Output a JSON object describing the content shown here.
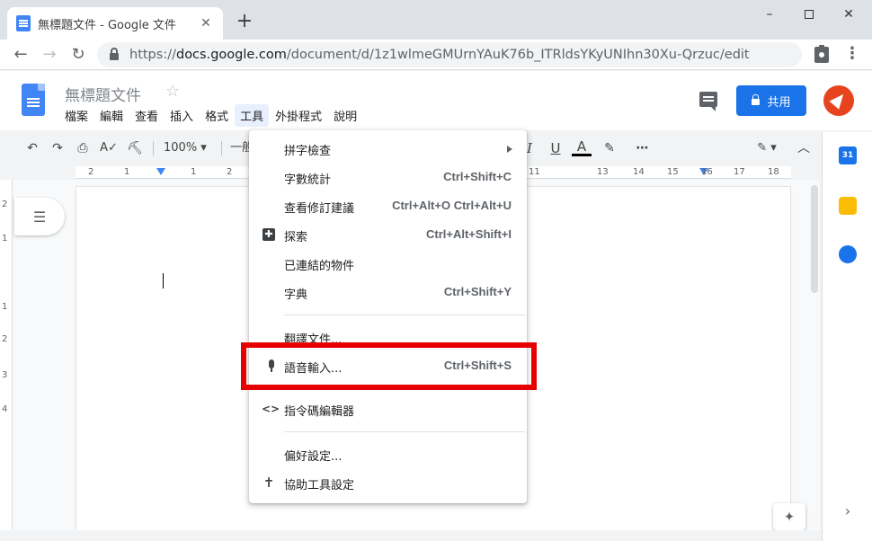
{
  "browser": {
    "tab_title": "無標題文件 - Google 文件",
    "tab_close": "✕",
    "new_tab": "+",
    "win_minimize": "–",
    "win_close": "✕",
    "nav_back": "←",
    "nav_forward": "→",
    "nav_reload": "↻",
    "url_prefix": "https://",
    "url_domain": "docs.google.com",
    "url_path": "/document/d/1z1wlmeGMUrnYAuK76b_ITRldsYKyUNIhn30Xu-Qrzuc/edit",
    "menu_kebab": "⋮"
  },
  "docs": {
    "title": "無標題文件",
    "star": "☆",
    "menus": [
      "檔案",
      "編輯",
      "查看",
      "插入",
      "格式",
      "工具",
      "外掛程式",
      "說明"
    ],
    "share_label": "共用"
  },
  "toolbar": {
    "undo": "↶",
    "redo": "↷",
    "print": "⎙",
    "spell": "A✓",
    "paint": "⛏",
    "zoom": "100%  ▾",
    "style": "一般",
    "italic": "I",
    "underline": "U",
    "text_color": "A",
    "highlight": "✎",
    "more": "⋯",
    "edit_mode": "✎ ▾",
    "collapse": "︿"
  },
  "ruler": {
    "numbers": [
      "2",
      "1",
      "1",
      "2",
      "11",
      "13",
      "14",
      "15",
      "16",
      "17",
      "18"
    ]
  },
  "vruler": {
    "numbers": [
      "2",
      "1",
      "1",
      "2",
      "3",
      "4"
    ]
  },
  "sidepanel": {
    "calendar_label": "31",
    "expand": "›"
  },
  "workspace": {
    "outline_icon": "☰",
    "explore_icon": "✦"
  },
  "tools_menu": {
    "items": [
      {
        "label": "拼字檢查",
        "shortcut": "",
        "icon": "",
        "submenu": true
      },
      {
        "label": "字數統計",
        "shortcut": "Ctrl+Shift+C",
        "icon": ""
      },
      {
        "label": "查看修訂建議",
        "shortcut": "Ctrl+Alt+O Ctrl+Alt+U",
        "icon": ""
      },
      {
        "label": "探索",
        "shortcut": "Ctrl+Alt+Shift+I",
        "icon": "explore-icon"
      },
      {
        "label": "已連結的物件",
        "shortcut": "",
        "icon": ""
      },
      {
        "label": "字典",
        "shortcut": "Ctrl+Shift+Y",
        "icon": ""
      },
      {
        "label": "翻譯文件...",
        "shortcut": "",
        "icon": ""
      },
      {
        "label": "語音輸入...",
        "shortcut": "Ctrl+Shift+S",
        "icon": "microphone-icon"
      },
      {
        "label": "指令碼編輯器",
        "shortcut": "",
        "icon": "code-icon"
      },
      {
        "label": "偏好設定...",
        "shortcut": "",
        "icon": ""
      },
      {
        "label": "協助工具設定",
        "shortcut": "",
        "icon": "accessibility-icon"
      }
    ],
    "explore_glyph": "✚",
    "code_glyph": "<>",
    "accessibility_glyph": "✝"
  },
  "colors": {
    "highlight_box": "#e60000",
    "share_button": "#1a73e8",
    "docs_blue": "#4285f4"
  }
}
